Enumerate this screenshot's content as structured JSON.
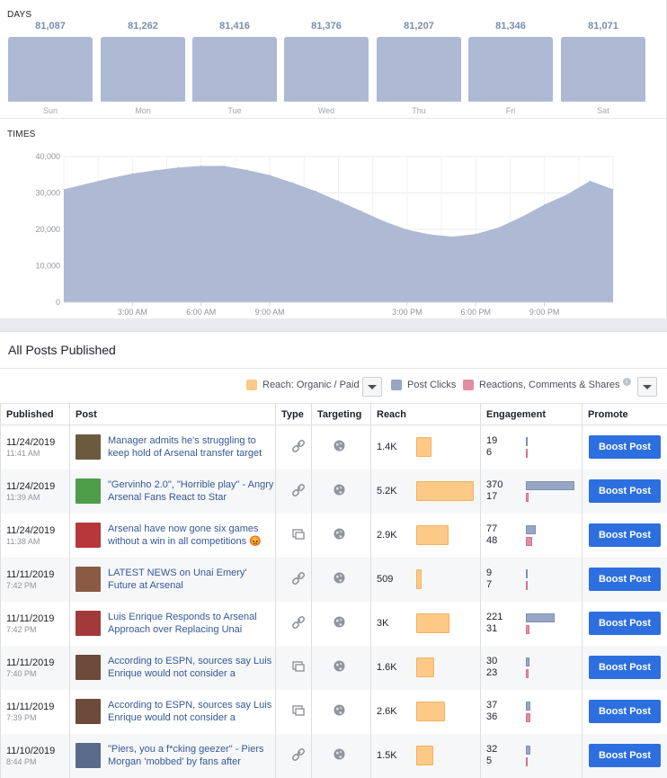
{
  "days": {
    "label": "DAYS",
    "items": [
      {
        "day": "Sun",
        "value": "81,087"
      },
      {
        "day": "Mon",
        "value": "81,262"
      },
      {
        "day": "Tue",
        "value": "81,416"
      },
      {
        "day": "Wed",
        "value": "81,376"
      },
      {
        "day": "Thu",
        "value": "81,207"
      },
      {
        "day": "Fri",
        "value": "81,346"
      },
      {
        "day": "Sat",
        "value": "81,071"
      }
    ]
  },
  "times": {
    "label": "TIMES",
    "y_ticks": [
      "0",
      "10,000",
      "20,000",
      "30,000",
      "40,000"
    ],
    "x_ticks": [
      "3:00 AM",
      "6:00 AM",
      "9:00 AM",
      "3:00 PM",
      "6:00 PM",
      "9:00 PM"
    ]
  },
  "chart_data": {
    "type": "area",
    "x_hours": [
      0,
      1,
      2,
      3,
      4,
      5,
      6,
      7,
      8,
      9,
      10,
      11,
      12,
      13,
      14,
      15,
      16,
      17,
      18,
      19,
      20,
      21,
      22,
      23,
      24
    ],
    "values": [
      31000,
      32500,
      34000,
      35300,
      36200,
      37000,
      37400,
      37400,
      36300,
      34900,
      32800,
      30500,
      27800,
      25000,
      22200,
      19900,
      18600,
      18000,
      18700,
      20500,
      23400,
      26800,
      29600,
      33300,
      31000
    ],
    "ylim": [
      0,
      40000
    ],
    "ylabel": "",
    "xlabel": "",
    "grid": true
  },
  "posts": {
    "title": "All Posts Published",
    "legend": {
      "reach": "Reach: Organic / Paid",
      "clicks": "Post Clicks",
      "reactions": "Reactions, Comments & Shares",
      "info_icon": "i"
    },
    "columns": {
      "published": "Published",
      "post": "Post",
      "type": "Type",
      "targeting": "Targeting",
      "reach": "Reach",
      "engagement": "Engagement",
      "promote": "Promote"
    },
    "boost_label": "Boost Post",
    "rows": [
      {
        "date": "11/24/2019",
        "time": "11:41 AM",
        "text": "Manager admits he's struggling to keep hold of Arsenal transfer target",
        "type": "link-icon",
        "reach": "1.4K",
        "reach_frac": 0.27,
        "clicks": "19",
        "reactions": "6",
        "clicks_frac": 0.04,
        "reactions_frac": 0.02,
        "thumb": "#6b5a3e"
      },
      {
        "date": "11/24/2019",
        "time": "11:39 AM",
        "text": "\"Gervinho 2.0\", \"Horrible play\" - Angry Arsenal Fans React to Star",
        "type": "link-icon",
        "reach": "5.2K",
        "reach_frac": 1.0,
        "clicks": "370",
        "reactions": "17",
        "clicks_frac": 1.0,
        "reactions_frac": 0.05,
        "thumb": "#4f9c4a"
      },
      {
        "date": "11/24/2019",
        "time": "11:38 AM",
        "text": "Arsenal have now gone six games without a win in all competitions 😡",
        "type": "album-icon",
        "reach": "2.9K",
        "reach_frac": 0.56,
        "clicks": "77",
        "reactions": "48",
        "clicks_frac": 0.21,
        "reactions_frac": 0.13,
        "thumb": "#b8373a"
      },
      {
        "date": "11/11/2019",
        "time": "7:42 PM",
        "text": "LATEST NEWS on Unai Emery' Future at Arsenal",
        "type": "link-icon",
        "reach": "509",
        "reach_frac": 0.1,
        "clicks": "9",
        "reactions": "7",
        "clicks_frac": 0.03,
        "reactions_frac": 0.02,
        "thumb": "#8a5a44"
      },
      {
        "date": "11/11/2019",
        "time": "7:42 PM",
        "text": "Luis Enrique Responds to Arsenal Approach over Replacing Unai",
        "type": "link-icon",
        "reach": "3K",
        "reach_frac": 0.58,
        "clicks": "221",
        "reactions": "31",
        "clicks_frac": 0.6,
        "reactions_frac": 0.08,
        "thumb": "#a33a3a"
      },
      {
        "date": "11/11/2019",
        "time": "7:40 PM",
        "text": "According to ESPN, sources say Luis Enrique would not consider a",
        "type": "album-icon",
        "reach": "1.6K",
        "reach_frac": 0.31,
        "clicks": "30",
        "reactions": "23",
        "clicks_frac": 0.08,
        "reactions_frac": 0.06,
        "thumb": "#6e4a3a"
      },
      {
        "date": "11/11/2019",
        "time": "7:39 PM",
        "text": "According to ESPN, sources say Luis Enrique would not consider a",
        "type": "album-icon",
        "reach": "2.6K",
        "reach_frac": 0.5,
        "clicks": "37",
        "reactions": "36",
        "clicks_frac": 0.1,
        "reactions_frac": 0.1,
        "thumb": "#6e4a3a"
      },
      {
        "date": "11/10/2019",
        "time": "8:44 PM",
        "text": "\"Piers, you a f*cking geezer\" - Piers Morgan 'mobbed' by fans after",
        "type": "link-icon",
        "reach": "1.5K",
        "reach_frac": 0.29,
        "clicks": "32",
        "reactions": "5",
        "clicks_frac": 0.09,
        "reactions_frac": 0.01,
        "thumb": "#5a6a8a"
      }
    ]
  }
}
